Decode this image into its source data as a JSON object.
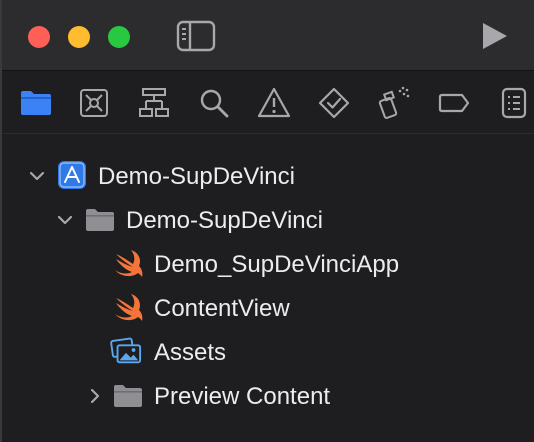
{
  "window": {
    "traffic_lights": [
      {
        "name": "close",
        "color": "#fe5f57"
      },
      {
        "name": "minimize",
        "color": "#febc2e"
      },
      {
        "name": "zoom",
        "color": "#28c840"
      }
    ],
    "toolbar": {
      "sidebar_toggle_icon": "sidebar-left-icon",
      "run_icon": "play-icon"
    }
  },
  "navigator_tabs": [
    {
      "icon": "folder-icon",
      "selected": true,
      "color": "#3b82f6"
    },
    {
      "icon": "source-control-icon",
      "selected": false
    },
    {
      "icon": "hierarchy-icon",
      "selected": false
    },
    {
      "icon": "magnifier-icon",
      "selected": false
    },
    {
      "icon": "warning-icon",
      "selected": false
    },
    {
      "icon": "test-diamond-icon",
      "selected": false
    },
    {
      "icon": "debug-spray-icon",
      "selected": false
    },
    {
      "icon": "breakpoint-tag-icon",
      "selected": false
    },
    {
      "icon": "report-list-icon",
      "selected": false
    }
  ],
  "project_tree": [
    {
      "label": "Demo-SupDeVinci",
      "icon": "xcode-project-icon",
      "level": 0,
      "expanded": true
    },
    {
      "label": "Demo-SupDeVinci",
      "icon": "folder-icon",
      "level": 1,
      "expanded": true
    },
    {
      "label": "Demo_SupDeVinciApp",
      "icon": "swift-icon",
      "level": 2
    },
    {
      "label": "ContentView",
      "icon": "swift-icon",
      "level": 2
    },
    {
      "label": "Assets",
      "icon": "asset-catalog-icon",
      "level": 2
    },
    {
      "label": "Preview Content",
      "icon": "folder-icon",
      "level": 2,
      "expanded": false
    }
  ],
  "colors": {
    "accent": "#3b82f6",
    "swift": "#f5743a",
    "folder": "#8e8e93",
    "icon_gray": "#a7a7ac"
  }
}
